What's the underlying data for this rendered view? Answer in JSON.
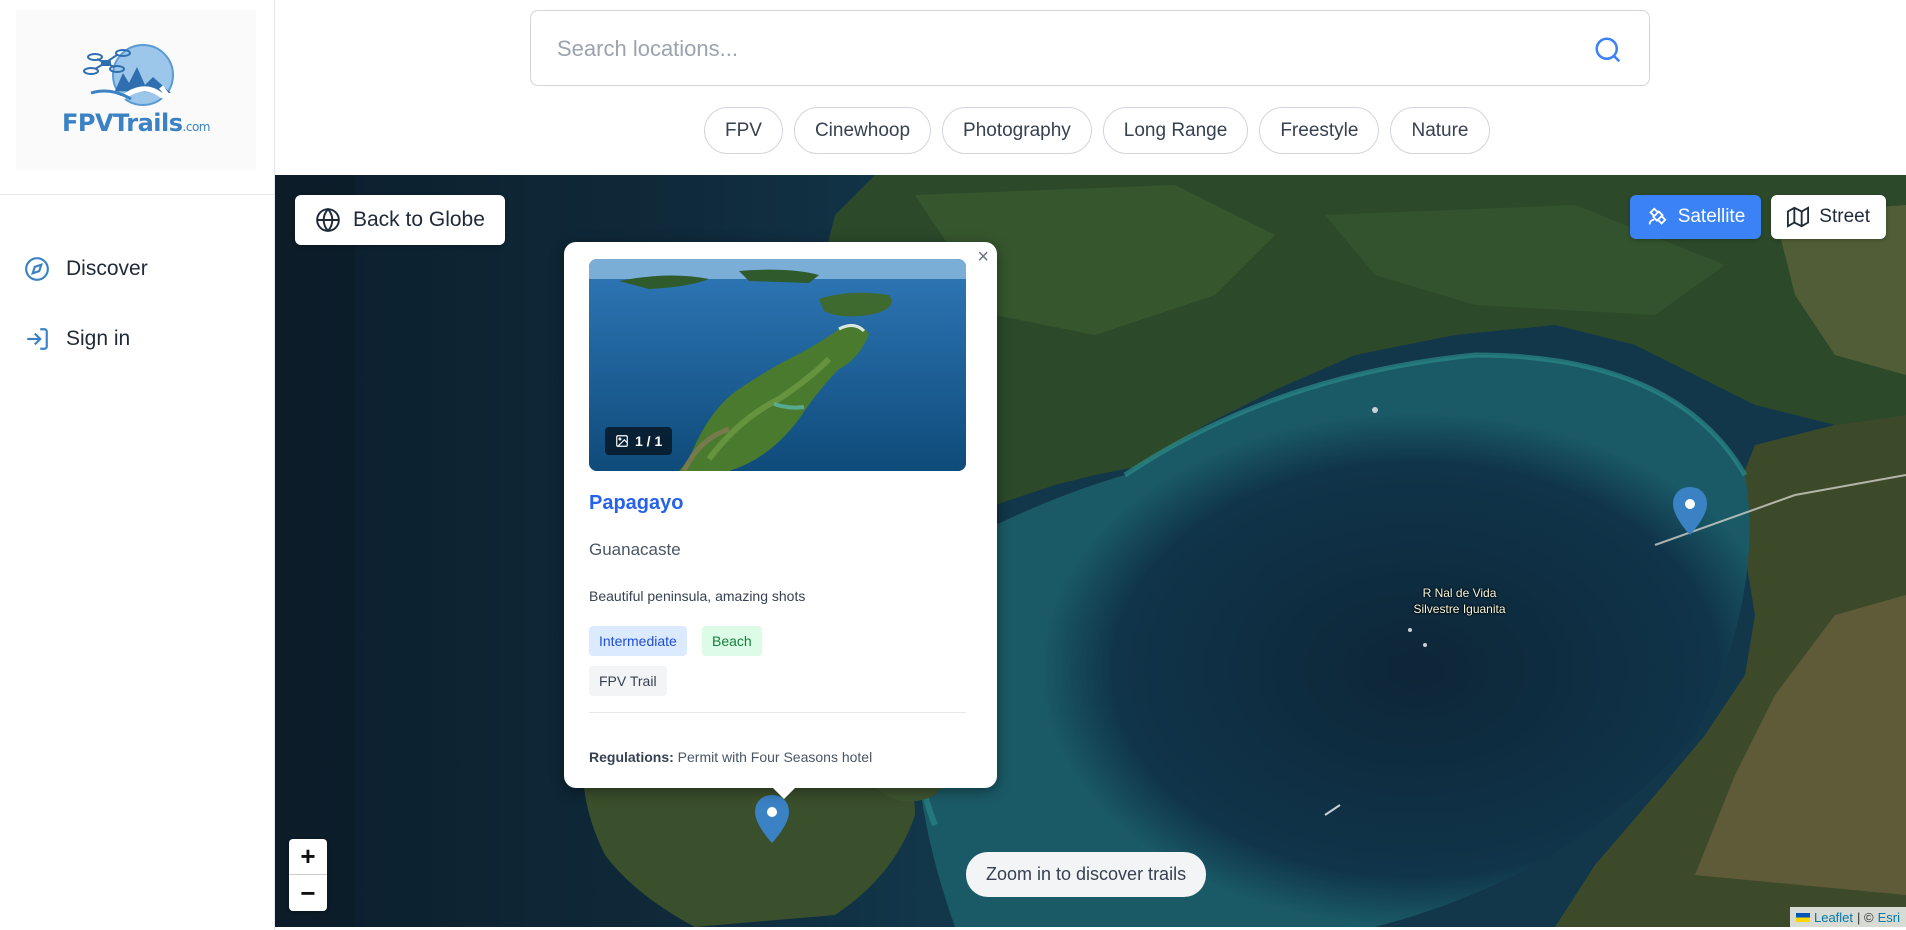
{
  "app": {
    "logo_text": "FPVTrails",
    "logo_suffix": ".com"
  },
  "sidebar": {
    "items": [
      {
        "label": "Discover",
        "icon": "compass-icon"
      },
      {
        "label": "Sign in",
        "icon": "sign-in-icon"
      }
    ]
  },
  "search": {
    "placeholder": "Search locations...",
    "value": ""
  },
  "filters": [
    "FPV",
    "Cinewhoop",
    "Photography",
    "Long Range",
    "Freestyle",
    "Nature"
  ],
  "map": {
    "back_label": "Back to Globe",
    "layers": {
      "satellite_label": "Satellite",
      "street_label": "Street",
      "active": "Satellite"
    },
    "zoom_in": "+",
    "zoom_out": "−",
    "hint": "Zoom in to discover trails",
    "place_label": "R Nal de Vida Silvestre Iguanita",
    "attribution": {
      "leaflet": "Leaflet",
      "separator": "| ©",
      "esri": "Esri"
    }
  },
  "popup": {
    "close": "×",
    "image_counter": "1 / 1",
    "title": "Papagayo",
    "region": "Guanacaste",
    "description": "Beautiful peninsula, amazing shots",
    "tags": [
      {
        "label": "Intermediate",
        "color": "blue"
      },
      {
        "label": "Beach",
        "color": "green"
      },
      {
        "label": "FPV Trail",
        "color": "gray"
      }
    ],
    "regulations_label": "Regulations:",
    "regulations_value": "Permit with Four Seasons hotel"
  },
  "colors": {
    "accent": "#3b82f6",
    "link": "#2563eb",
    "pin": "#3b82c4"
  }
}
